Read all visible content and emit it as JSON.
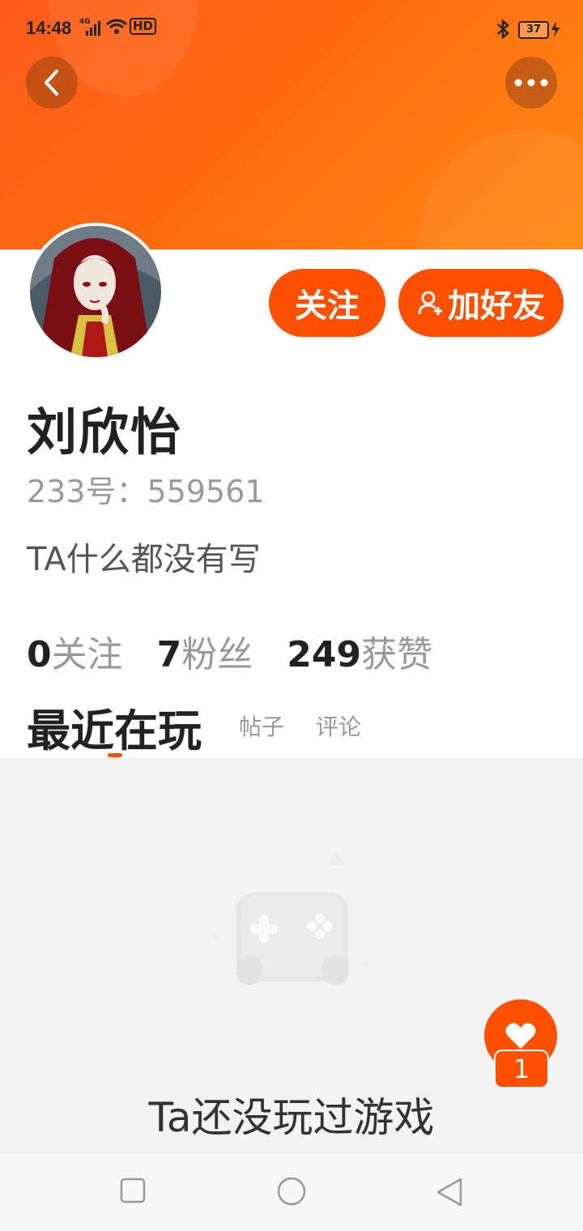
{
  "status_bar": {
    "time": "14:48",
    "network": "4G",
    "hd": "HD",
    "battery": "37"
  },
  "profile": {
    "name": "刘欣怡",
    "uid": "233号：559561",
    "bio": "TA什么都没有写",
    "follow_label": "关注",
    "add_friend_label": "加好友"
  },
  "stats": [
    {
      "num": "0",
      "label": "关注"
    },
    {
      "num": "7",
      "label": "粉丝"
    },
    {
      "num": "249",
      "label": "获赞"
    }
  ],
  "tabs": {
    "recent": "最近在玩",
    "posts": "帖子",
    "comments": "评论"
  },
  "empty_state": {
    "text": "Ta还没玩过游戏"
  },
  "like_fab": {
    "count": "1"
  },
  "colors": {
    "accent": "#ff5000",
    "banner": "#ff6a10"
  },
  "icons": [
    "back-arrow-icon",
    "more-dots-icon",
    "bluetooth-icon",
    "add-person-icon",
    "gamepad-icon",
    "heart-icon",
    "nav-square-icon",
    "nav-circle-icon",
    "nav-back-triangle-icon"
  ]
}
